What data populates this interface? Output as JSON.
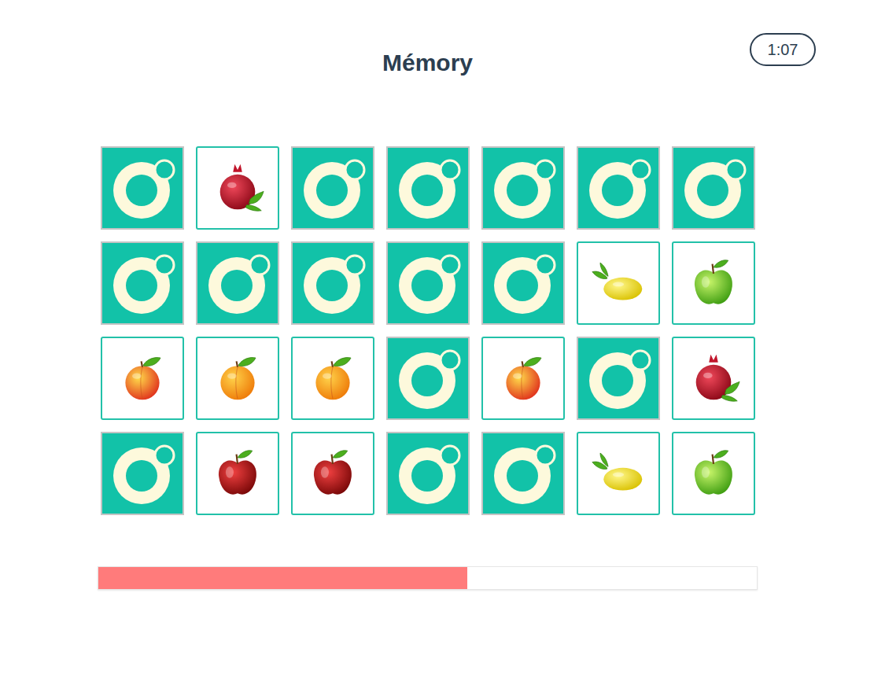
{
  "title": "Mémory",
  "timer": "1:07",
  "cards": [
    {
      "kind": "back",
      "face_up": false
    },
    {
      "kind": "pomegranate",
      "face_up": true
    },
    {
      "kind": "back",
      "face_up": false
    },
    {
      "kind": "back",
      "face_up": false
    },
    {
      "kind": "back",
      "face_up": false
    },
    {
      "kind": "back",
      "face_up": false
    },
    {
      "kind": "back",
      "face_up": false
    },
    {
      "kind": "back",
      "face_up": false
    },
    {
      "kind": "back",
      "face_up": false
    },
    {
      "kind": "back",
      "face_up": false
    },
    {
      "kind": "back",
      "face_up": false
    },
    {
      "kind": "back",
      "face_up": false
    },
    {
      "kind": "lemon",
      "face_up": true
    },
    {
      "kind": "green-apple",
      "face_up": true
    },
    {
      "kind": "peach",
      "face_up": true
    },
    {
      "kind": "apricot",
      "face_up": true
    },
    {
      "kind": "apricot",
      "face_up": true
    },
    {
      "kind": "back",
      "face_up": false
    },
    {
      "kind": "peach",
      "face_up": true
    },
    {
      "kind": "back",
      "face_up": false
    },
    {
      "kind": "pomegranate",
      "face_up": true
    },
    {
      "kind": "back",
      "face_up": false
    },
    {
      "kind": "red-apple",
      "face_up": true
    },
    {
      "kind": "red-apple",
      "face_up": true
    },
    {
      "kind": "back",
      "face_up": false
    },
    {
      "kind": "back",
      "face_up": false
    },
    {
      "kind": "lemon",
      "face_up": true
    },
    {
      "kind": "green-apple",
      "face_up": true
    }
  ],
  "progress": {
    "level": 0.56
  }
}
